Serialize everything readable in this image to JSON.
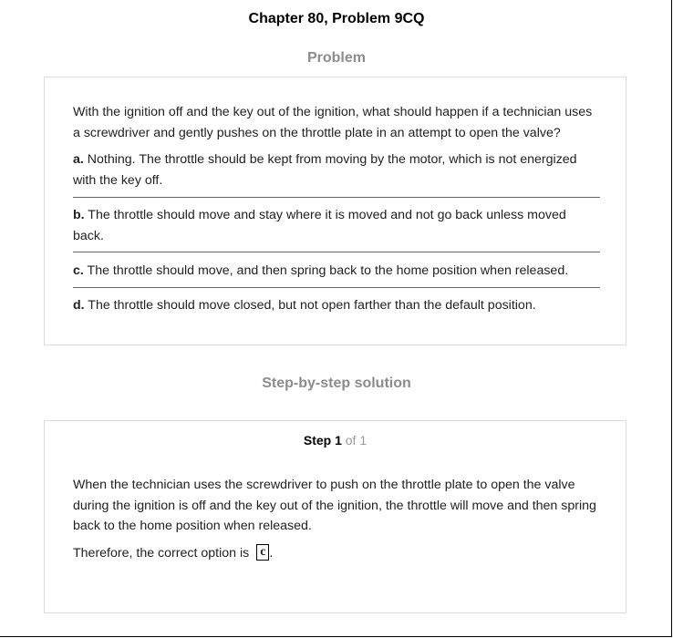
{
  "header": {
    "title": "Chapter 80, Problem 9CQ"
  },
  "problem": {
    "heading": "Problem",
    "question": "With the ignition off and the key out of the ignition, what should happen if a technician uses a screwdriver and gently pushes on the throttle plate in an attempt to open the valve?",
    "options": [
      {
        "letter": "a.",
        "text": " Nothing. The throttle should be kept from moving by the motor, which is not energized with the key off."
      },
      {
        "letter": "b.",
        "text": " The throttle should move and stay where it is moved and not go back unless moved back."
      },
      {
        "letter": "c.",
        "text": " The throttle should move, and then spring back to the home position when released."
      },
      {
        "letter": "d.",
        "text": " The throttle should move closed, but not open farther than the default position."
      }
    ]
  },
  "solution": {
    "heading": "Step-by-step solution",
    "step_label": "Step 1",
    "step_of": " of 1",
    "explanation": "When the technician uses the screwdriver to push on the throttle plate to open the valve during the ignition is off and the key out of the ignition, the throttle will move and then spring back to the home position when released.",
    "conclusion_prefix": "Therefore, the correct option is",
    "answer": "c",
    "conclusion_suffix": "."
  }
}
